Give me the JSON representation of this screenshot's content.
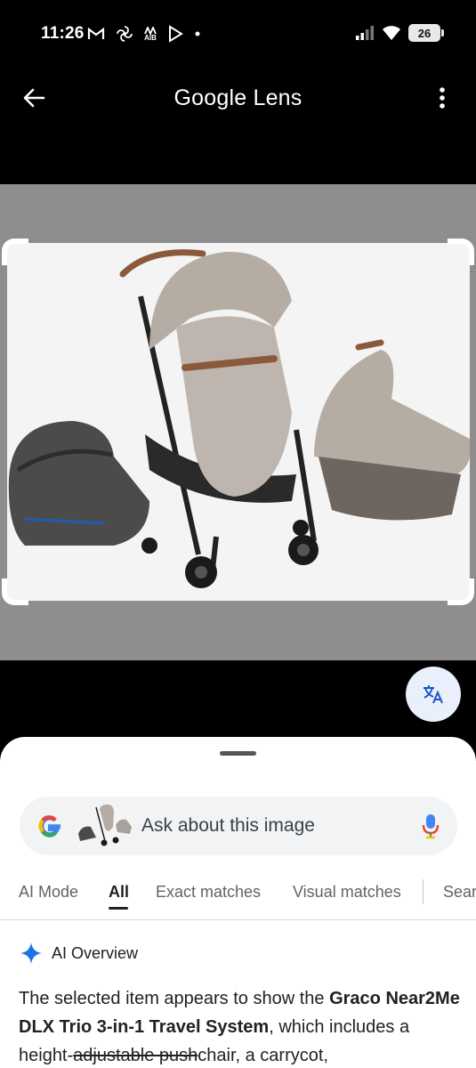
{
  "status_bar": {
    "time": "11:26",
    "battery": "26",
    "left_icons": [
      "gmail-icon",
      "pinwheel-icon",
      "aib-icon",
      "play-icon",
      "dot-icon"
    ],
    "aib_label": "AIB",
    "right_icons": [
      "signal-icon",
      "wifi-icon",
      "battery-icon"
    ]
  },
  "app_bar": {
    "title": "Google Lens",
    "back_icon": "arrow-left-icon",
    "more_icon": "more-vert-icon"
  },
  "translate_icon": "translate-icon",
  "search": {
    "placeholder": "Ask about this image",
    "logo_icon": "google-g-icon",
    "mic_icon": "mic-icon"
  },
  "tabs": [
    {
      "label": "AI Mode",
      "active": false
    },
    {
      "label": "All",
      "active": true
    },
    {
      "label": "Exact matches",
      "active": false
    },
    {
      "label": "Visual matches",
      "active": false
    },
    {
      "label": "Sear",
      "active": false
    }
  ],
  "ai_overview": {
    "label": "AI Overview",
    "icon": "sparkle-icon",
    "text_1": "The selected item appears to show the ",
    "text_bold": "Graco Near2Me DLX Trio 3-in-1 Travel System",
    "text_2": ", which includes a height-",
    "text_strike": "adjustable push",
    "text_3": "chair, a carrycot,"
  },
  "colors": {
    "accent_blue": "#1a73e8",
    "image_backdrop": "#8e8e8e"
  }
}
